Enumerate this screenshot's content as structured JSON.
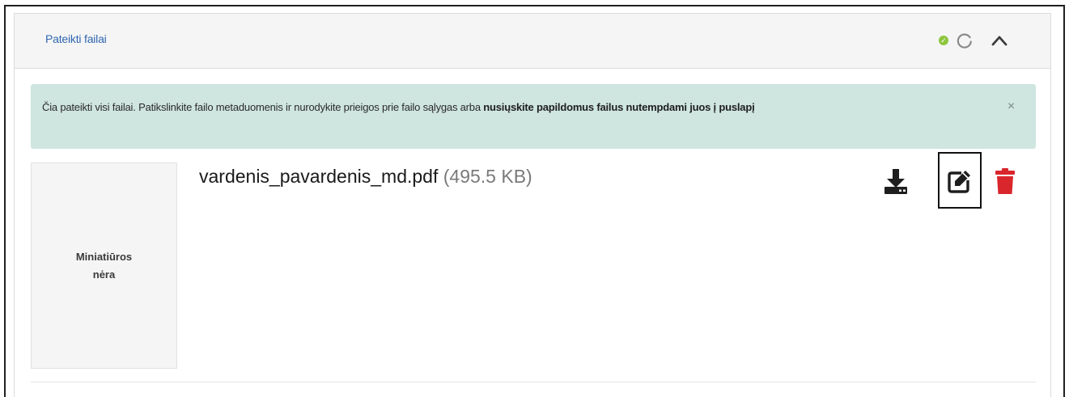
{
  "panel": {
    "title": "Pateikti failai",
    "status_check": "✓",
    "icons": {
      "status": "check-circle-icon",
      "refresh": "refresh-icon",
      "collapse": "chevron-up-icon"
    },
    "colors": {
      "title": "#2f67b0",
      "status": "#8dc63f",
      "alert_bg": "#cfe5df",
      "delete": "#d9262c"
    }
  },
  "alert": {
    "text": "Čia pateikti visi failai. Patikslinkite failo metaduomenis ir nurodykite prieigos prie failo sąlygas arba ",
    "bold_text": "nusiųskite papildomus failus nutempdami juos į puslapį",
    "close": "×"
  },
  "file": {
    "thumbnail_label": "Miniatiūros nėra",
    "name": "vardenis_pavardenis_md.pdf",
    "size": "(495.5 KB)",
    "actions": {
      "download": "download-icon",
      "edit": "edit-icon",
      "delete": "trash-icon"
    }
  }
}
